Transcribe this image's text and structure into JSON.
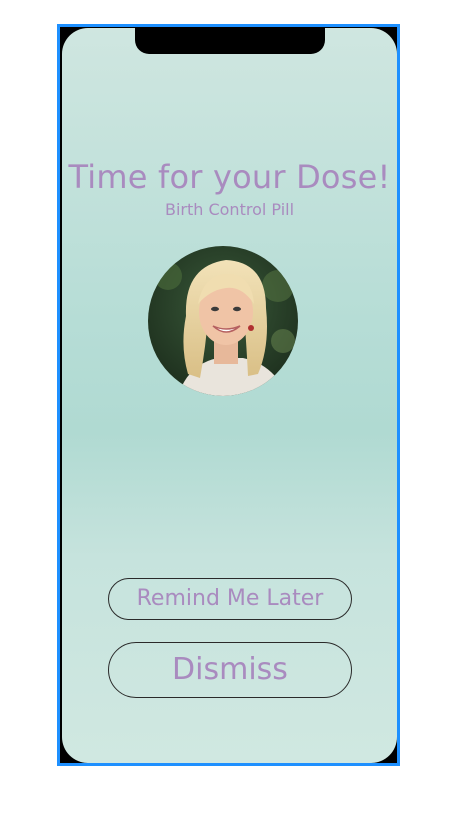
{
  "alert": {
    "title": "Time for your Dose!",
    "subtitle": "Birth Control Pill"
  },
  "actions": {
    "remind_label": "Remind Me Later",
    "dismiss_label": "Dismiss"
  },
  "colors": {
    "accent_text": "#a98bbf",
    "frame_selection": "#1e90ff",
    "background_top": "#cfe6e0",
    "background_mid": "#b0dad2"
  }
}
